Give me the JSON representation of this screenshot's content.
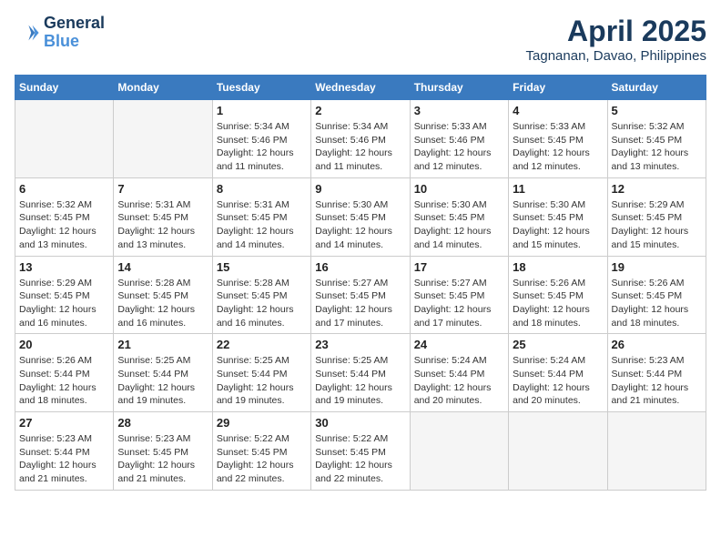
{
  "header": {
    "logo_line1": "General",
    "logo_line2": "Blue",
    "month_title": "April 2025",
    "location": "Tagnanan, Davao, Philippines"
  },
  "days_of_week": [
    "Sunday",
    "Monday",
    "Tuesday",
    "Wednesday",
    "Thursday",
    "Friday",
    "Saturday"
  ],
  "weeks": [
    [
      {
        "day": null,
        "info": null
      },
      {
        "day": null,
        "info": null
      },
      {
        "day": "1",
        "info": "Sunrise: 5:34 AM\nSunset: 5:46 PM\nDaylight: 12 hours and 11 minutes."
      },
      {
        "day": "2",
        "info": "Sunrise: 5:34 AM\nSunset: 5:46 PM\nDaylight: 12 hours and 11 minutes."
      },
      {
        "day": "3",
        "info": "Sunrise: 5:33 AM\nSunset: 5:46 PM\nDaylight: 12 hours and 12 minutes."
      },
      {
        "day": "4",
        "info": "Sunrise: 5:33 AM\nSunset: 5:45 PM\nDaylight: 12 hours and 12 minutes."
      },
      {
        "day": "5",
        "info": "Sunrise: 5:32 AM\nSunset: 5:45 PM\nDaylight: 12 hours and 13 minutes."
      }
    ],
    [
      {
        "day": "6",
        "info": "Sunrise: 5:32 AM\nSunset: 5:45 PM\nDaylight: 12 hours and 13 minutes."
      },
      {
        "day": "7",
        "info": "Sunrise: 5:31 AM\nSunset: 5:45 PM\nDaylight: 12 hours and 13 minutes."
      },
      {
        "day": "8",
        "info": "Sunrise: 5:31 AM\nSunset: 5:45 PM\nDaylight: 12 hours and 14 minutes."
      },
      {
        "day": "9",
        "info": "Sunrise: 5:30 AM\nSunset: 5:45 PM\nDaylight: 12 hours and 14 minutes."
      },
      {
        "day": "10",
        "info": "Sunrise: 5:30 AM\nSunset: 5:45 PM\nDaylight: 12 hours and 14 minutes."
      },
      {
        "day": "11",
        "info": "Sunrise: 5:30 AM\nSunset: 5:45 PM\nDaylight: 12 hours and 15 minutes."
      },
      {
        "day": "12",
        "info": "Sunrise: 5:29 AM\nSunset: 5:45 PM\nDaylight: 12 hours and 15 minutes."
      }
    ],
    [
      {
        "day": "13",
        "info": "Sunrise: 5:29 AM\nSunset: 5:45 PM\nDaylight: 12 hours and 16 minutes."
      },
      {
        "day": "14",
        "info": "Sunrise: 5:28 AM\nSunset: 5:45 PM\nDaylight: 12 hours and 16 minutes."
      },
      {
        "day": "15",
        "info": "Sunrise: 5:28 AM\nSunset: 5:45 PM\nDaylight: 12 hours and 16 minutes."
      },
      {
        "day": "16",
        "info": "Sunrise: 5:27 AM\nSunset: 5:45 PM\nDaylight: 12 hours and 17 minutes."
      },
      {
        "day": "17",
        "info": "Sunrise: 5:27 AM\nSunset: 5:45 PM\nDaylight: 12 hours and 17 minutes."
      },
      {
        "day": "18",
        "info": "Sunrise: 5:26 AM\nSunset: 5:45 PM\nDaylight: 12 hours and 18 minutes."
      },
      {
        "day": "19",
        "info": "Sunrise: 5:26 AM\nSunset: 5:45 PM\nDaylight: 12 hours and 18 minutes."
      }
    ],
    [
      {
        "day": "20",
        "info": "Sunrise: 5:26 AM\nSunset: 5:44 PM\nDaylight: 12 hours and 18 minutes."
      },
      {
        "day": "21",
        "info": "Sunrise: 5:25 AM\nSunset: 5:44 PM\nDaylight: 12 hours and 19 minutes."
      },
      {
        "day": "22",
        "info": "Sunrise: 5:25 AM\nSunset: 5:44 PM\nDaylight: 12 hours and 19 minutes."
      },
      {
        "day": "23",
        "info": "Sunrise: 5:25 AM\nSunset: 5:44 PM\nDaylight: 12 hours and 19 minutes."
      },
      {
        "day": "24",
        "info": "Sunrise: 5:24 AM\nSunset: 5:44 PM\nDaylight: 12 hours and 20 minutes."
      },
      {
        "day": "25",
        "info": "Sunrise: 5:24 AM\nSunset: 5:44 PM\nDaylight: 12 hours and 20 minutes."
      },
      {
        "day": "26",
        "info": "Sunrise: 5:23 AM\nSunset: 5:44 PM\nDaylight: 12 hours and 21 minutes."
      }
    ],
    [
      {
        "day": "27",
        "info": "Sunrise: 5:23 AM\nSunset: 5:44 PM\nDaylight: 12 hours and 21 minutes."
      },
      {
        "day": "28",
        "info": "Sunrise: 5:23 AM\nSunset: 5:45 PM\nDaylight: 12 hours and 21 minutes."
      },
      {
        "day": "29",
        "info": "Sunrise: 5:22 AM\nSunset: 5:45 PM\nDaylight: 12 hours and 22 minutes."
      },
      {
        "day": "30",
        "info": "Sunrise: 5:22 AM\nSunset: 5:45 PM\nDaylight: 12 hours and 22 minutes."
      },
      {
        "day": null,
        "info": null
      },
      {
        "day": null,
        "info": null
      },
      {
        "day": null,
        "info": null
      }
    ]
  ]
}
